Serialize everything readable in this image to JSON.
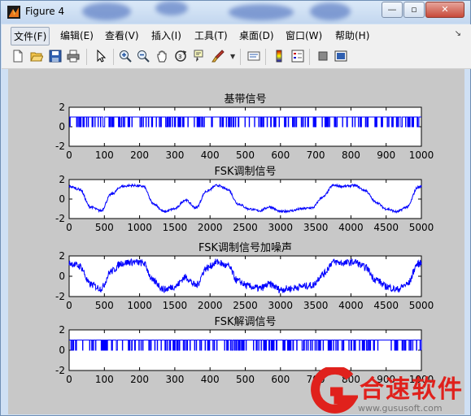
{
  "window": {
    "title": "Figure 4",
    "controls": {
      "minimize": "—",
      "maximize": "▫",
      "close": "✕"
    }
  },
  "menubar": [
    "文件(F)",
    "编辑(E)",
    "查看(V)",
    "插入(I)",
    "工具(T)",
    "桌面(D)",
    "窗口(W)",
    "帮助(H)"
  ],
  "toolbar": [
    "new-figure-icon",
    "open-file-icon",
    "save-icon",
    "print-icon",
    "pointer-icon",
    "zoom-in-icon",
    "zoom-out-icon",
    "pan-icon",
    "rotate-3d-icon",
    "data-cursor-icon",
    "brush-icon",
    "link-icon",
    "colorbar-icon",
    "legend-icon",
    "hide-plot-tools-icon",
    "show-plot-tools-icon"
  ],
  "watermark": {
    "brand": "合速软件",
    "url": "www.gususoft.com"
  },
  "colors": {
    "plot_line": "#0000ff",
    "figure_bg": "#c8c8c8",
    "watermark_red": "#e0211c"
  },
  "chart_data": [
    {
      "type": "line",
      "title": "基带信号",
      "xlim": [
        0,
        1000
      ],
      "ylim": [
        -2,
        2
      ],
      "xticks": [
        0,
        100,
        200,
        300,
        400,
        500,
        600,
        700,
        800,
        900,
        1000
      ],
      "yticks": [
        -2,
        0,
        2
      ],
      "signal": "random binary square wave between 0 and 1"
    },
    {
      "type": "line",
      "title": "FSK调制信号",
      "xlim": [
        0,
        5000
      ],
      "ylim": [
        -2,
        2
      ],
      "xticks": [
        0,
        500,
        1000,
        1500,
        2000,
        2500,
        3000,
        3500,
        4000,
        4500,
        5000
      ],
      "yticks": [
        -2,
        0,
        2
      ],
      "x": [
        0,
        150,
        300,
        450,
        600,
        750,
        900,
        1050,
        1200,
        1350,
        1500,
        1650,
        1800,
        1950,
        2100,
        2250,
        2400,
        2550,
        2700,
        2850,
        3000,
        3150,
        3300,
        3450,
        3600,
        3750,
        3900,
        4050,
        4200,
        4350,
        4500,
        4650,
        4800,
        4950,
        5000
      ],
      "y": [
        1.3,
        1.0,
        -0.8,
        -1.2,
        0.5,
        1.3,
        1.4,
        1.3,
        -0.5,
        -1.3,
        -1.0,
        -0.1,
        -0.9,
        0.8,
        1.4,
        1.0,
        -0.5,
        -1.0,
        -1.2,
        -0.8,
        -1.3,
        -1.2,
        -1.0,
        -0.9,
        0.2,
        1.4,
        1.3,
        1.4,
        0.9,
        -0.3,
        -1.0,
        -1.3,
        -0.8,
        1.2,
        1.3
      ],
      "noise": 0.12
    },
    {
      "type": "line",
      "title": "FSK调制信号加噪声",
      "xlim": [
        0,
        5000
      ],
      "ylim": [
        -2,
        2
      ],
      "xticks": [
        0,
        500,
        1000,
        1500,
        2000,
        2500,
        3000,
        3500,
        4000,
        4500,
        5000
      ],
      "yticks": [
        -2,
        0,
        2
      ],
      "x": [
        0,
        150,
        300,
        450,
        600,
        750,
        900,
        1050,
        1200,
        1350,
        1500,
        1650,
        1800,
        1950,
        2100,
        2250,
        2400,
        2550,
        2700,
        2850,
        3000,
        3150,
        3300,
        3450,
        3600,
        3750,
        3900,
        4050,
        4200,
        4350,
        4500,
        4650,
        4800,
        4950,
        5000
      ],
      "y": [
        1.3,
        1.0,
        -0.8,
        -1.2,
        0.5,
        1.3,
        1.4,
        1.3,
        -0.5,
        -1.3,
        -1.0,
        -0.1,
        -0.9,
        0.8,
        1.4,
        1.0,
        -0.5,
        -1.0,
        -1.2,
        -0.8,
        -1.3,
        -1.2,
        -1.0,
        -0.9,
        0.2,
        1.4,
        1.3,
        1.4,
        0.9,
        -0.3,
        -1.0,
        -1.3,
        -0.8,
        1.2,
        1.3
      ],
      "noise": 0.35
    },
    {
      "type": "line",
      "title": "FSK解调信号",
      "xlim": [
        0,
        1000
      ],
      "ylim": [
        -2,
        2
      ],
      "xticks": [
        0,
        100,
        200,
        300,
        400,
        500,
        600,
        700,
        800,
        900,
        1000
      ],
      "yticks": [
        -2,
        0,
        2
      ],
      "signal": "random binary square wave between 0 and 1"
    }
  ]
}
